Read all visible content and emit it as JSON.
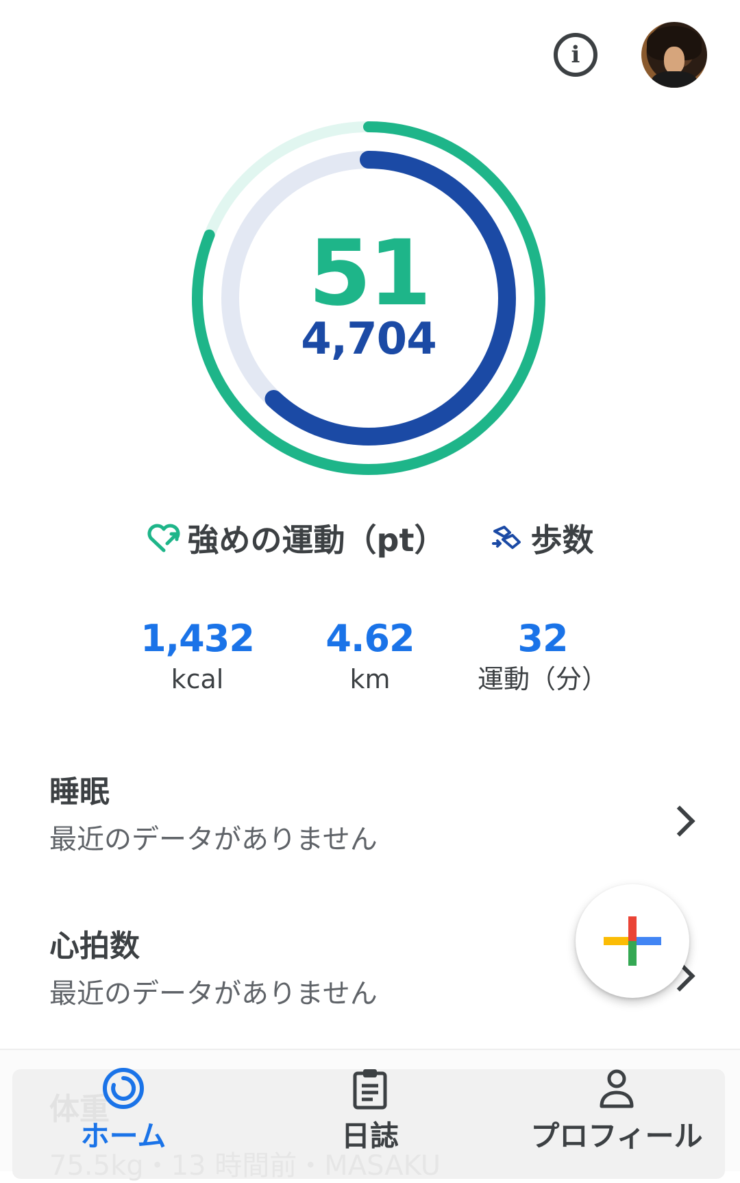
{
  "header": {
    "info_icon": "info-icon",
    "avatar": "profile-avatar"
  },
  "ring": {
    "heart_points": "51",
    "steps": "4,704",
    "outer_progress": 0.81,
    "inner_progress": 0.62,
    "outer_color": "#1eb589",
    "inner_color": "#1b4aa5"
  },
  "legend": {
    "heart_points_label": "強めの運動（pt）",
    "steps_label": "歩数"
  },
  "stats": [
    {
      "value": "1,432",
      "unit": "kcal"
    },
    {
      "value": "4.62",
      "unit": "km"
    },
    {
      "value": "32",
      "unit": "運動（分）"
    }
  ],
  "cards": [
    {
      "title": "睡眠",
      "subtitle": "最近のデータがありません"
    },
    {
      "title": "心拍数",
      "subtitle": "最近のデータがありません"
    }
  ],
  "ghost_card": {
    "title": "体重",
    "subtitle": "75.5kg・13 時間前・MASAKU"
  },
  "nav": [
    {
      "label": "ホーム",
      "icon": "home-ring-icon",
      "active": true
    },
    {
      "label": "日誌",
      "icon": "journal-clipboard-icon",
      "active": false
    },
    {
      "label": "プロフィール",
      "icon": "person-icon",
      "active": false
    }
  ],
  "colors": {
    "accent_green": "#1eb589",
    "accent_blue": "#1b4aa5",
    "stat_blue": "#1a73e8",
    "nav_active": "#1a73e8",
    "nav_inactive": "#3c4043"
  }
}
